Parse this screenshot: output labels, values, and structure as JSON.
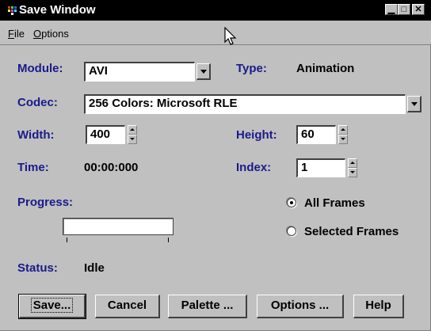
{
  "window": {
    "title": "Save Window"
  },
  "titlebar_buttons": {
    "minimize": "▁",
    "maximize": "□",
    "close": "✕"
  },
  "menu": [
    {
      "label": "File",
      "accel": "F",
      "rest": "ile"
    },
    {
      "label": "Options",
      "accel": "O",
      "rest": "ptions"
    }
  ],
  "module": {
    "label": "Module:",
    "value": "AVI"
  },
  "type": {
    "label": "Type:",
    "value": "Animation"
  },
  "codec": {
    "label": "Codec:",
    "value": "256 Colors: Microsoft RLE"
  },
  "width": {
    "label": "Width:",
    "value": "400"
  },
  "height": {
    "label": "Height:",
    "value": "60"
  },
  "time": {
    "label": "Time:",
    "value": "00:00:000"
  },
  "index": {
    "label": "Index:",
    "value": "1"
  },
  "progress": {
    "label": "Progress:",
    "fraction": 0
  },
  "frames": {
    "all_label": "All Frames",
    "selected_label": "Selected Frames",
    "selected": "all"
  },
  "status": {
    "label": "Status:",
    "value": "Idle"
  },
  "buttons": {
    "save": "Save...",
    "cancel": "Cancel",
    "palette": "Palette ...",
    "options": "Options ...",
    "help": "Help"
  }
}
